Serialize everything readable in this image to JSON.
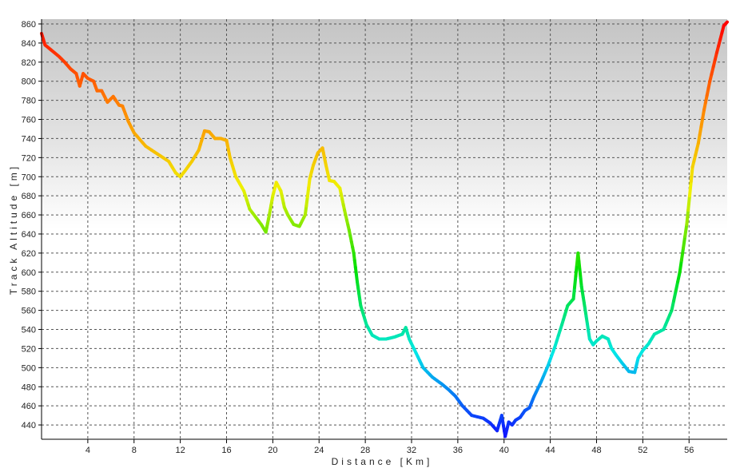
{
  "chart_data": {
    "type": "line",
    "title": "",
    "xlabel": "Distance [Km]",
    "ylabel": "Track Altitude [m]",
    "xlim": [
      0,
      59.3
    ],
    "ylim": [
      425,
      865
    ],
    "grid": true,
    "x_ticks": [
      4,
      8,
      12,
      16,
      20,
      24,
      28,
      32,
      36,
      40,
      44,
      48,
      52,
      56
    ],
    "y_ticks": [
      440,
      460,
      480,
      500,
      520,
      540,
      560,
      580,
      600,
      620,
      640,
      660,
      680,
      700,
      720,
      740,
      760,
      780,
      800,
      820,
      840,
      860
    ],
    "series": [
      {
        "x": [
          0,
          0.3,
          1,
          1.5,
          2,
          2.5,
          3,
          3.3,
          3.6,
          4,
          4.5,
          4.8,
          5.2,
          5.7,
          6.2,
          6.7,
          7,
          7.5,
          8,
          9,
          10,
          11,
          11.6,
          12,
          12.4,
          13,
          13.6,
          14.1,
          14.5,
          15,
          15.5,
          16,
          16.3,
          16.8,
          17.5,
          18,
          19,
          19.4,
          19.7,
          20,
          20.3,
          20.7,
          21,
          21.3,
          21.8,
          22.3,
          22.8,
          23.2,
          23.5,
          23.9,
          24.3,
          24.6,
          24.9,
          25.3,
          25.8,
          26.2,
          26.6,
          27,
          27.3,
          27.6,
          28.1,
          28.6,
          29.2,
          29.8,
          30.5,
          31.2,
          31.5,
          31.8,
          32.4,
          33,
          33.8,
          34.6,
          35.2,
          35.8,
          36.4,
          37.2,
          38.2,
          38.8,
          39.4,
          39.8,
          40.1,
          40.4,
          40.7,
          41,
          41.4,
          41.8,
          42.2,
          42.6,
          43.2,
          43.8,
          44.4,
          45,
          45.5,
          46,
          46.4,
          46.7,
          47,
          47.4,
          47.7,
          48,
          48.5,
          49,
          49.3,
          49.7,
          50.2,
          50.8,
          51.3,
          51.6,
          52,
          52.5,
          53,
          53.8,
          54.5,
          55.2,
          55.8,
          56.3,
          56.8,
          57.3,
          57.8,
          58.4,
          59,
          59.3
        ],
        "y": [
          850,
          838,
          831,
          826,
          820,
          813,
          808,
          795,
          808,
          803,
          800,
          790,
          790,
          778,
          784,
          775,
          774,
          758,
          746,
          732,
          724,
          716,
          704,
          700,
          706,
          716,
          728,
          748,
          747,
          740,
          740,
          738,
          720,
          700,
          685,
          666,
          650,
          642,
          660,
          680,
          694,
          685,
          668,
          660,
          650,
          648,
          660,
          698,
          712,
          725,
          730,
          712,
          696,
          695,
          688,
          665,
          644,
          620,
          590,
          565,
          545,
          534,
          530,
          530,
          532,
          535,
          542,
          530,
          515,
          500,
          490,
          483,
          477,
          470,
          460,
          450,
          447,
          442,
          434,
          450,
          428,
          443,
          440,
          445,
          448,
          455,
          458,
          470,
          485,
          502,
          522,
          545,
          565,
          572,
          620,
          585,
          562,
          530,
          524,
          528,
          533,
          530,
          520,
          513,
          505,
          496,
          495,
          510,
          518,
          525,
          535,
          540,
          560,
          600,
          650,
          710,
          735,
          770,
          800,
          830,
          858,
          862
        ]
      }
    ],
    "color_scale": [
      "#1010ff",
      "#00e8e8",
      "#00e000",
      "#f0f000",
      "#ff8000",
      "#ff0000"
    ]
  }
}
